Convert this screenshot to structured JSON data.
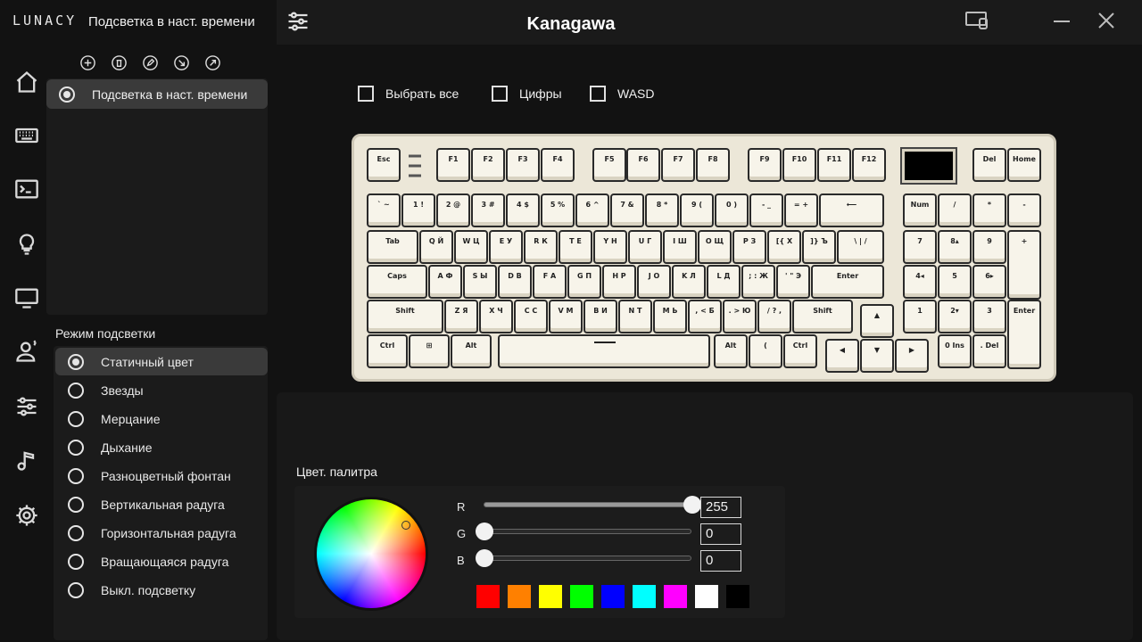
{
  "app": {
    "logo": "LUNACY",
    "profile_title": "Подсветка в наст. времени",
    "window_title": "Kanagawa"
  },
  "nav": {
    "items": [
      {
        "icon": "home-icon"
      },
      {
        "icon": "keyboard-icon"
      },
      {
        "icon": "terminal-icon"
      },
      {
        "icon": "lightbulb-icon"
      },
      {
        "icon": "monitor-icon"
      },
      {
        "icon": "user-icon"
      },
      {
        "icon": "sliders-icon"
      },
      {
        "icon": "music-icon"
      },
      {
        "icon": "gear-icon"
      }
    ]
  },
  "profile_tools": [
    {
      "icon": "add-icon"
    },
    {
      "icon": "delete-icon"
    },
    {
      "icon": "edit-icon"
    },
    {
      "icon": "import-icon"
    },
    {
      "icon": "export-icon"
    }
  ],
  "profiles": [
    {
      "label": "Подсветка в наст. времени",
      "selected": true
    }
  ],
  "lighting": {
    "header": "Режим подсветки",
    "modes": [
      {
        "label": "Статичный цвет",
        "selected": true
      },
      {
        "label": "Звезды",
        "selected": false
      },
      {
        "label": "Мерцание",
        "selected": false
      },
      {
        "label": "Дыхание",
        "selected": false
      },
      {
        "label": "Разноцветный фонтан",
        "selected": false
      },
      {
        "label": "Вертикальная радуга",
        "selected": false
      },
      {
        "label": "Горизонтальная радуга",
        "selected": false
      },
      {
        "label": "Вращающаяся радуга",
        "selected": false
      },
      {
        "label": "Выкл. подсветку",
        "selected": false
      }
    ]
  },
  "selection": {
    "select_all": "Выбрать все",
    "digits": "Цифры",
    "wasd": "WASD"
  },
  "keyboard": {
    "rows": [
      [
        "Esc",
        "F1",
        "F2",
        "F3",
        "F4",
        "F5",
        "F6",
        "F7",
        "F8",
        "F9",
        "F10",
        "F11",
        "F12",
        "Del",
        "Home"
      ],
      [
        "` ~",
        "1 !",
        "2 @",
        "3 #",
        "4 $",
        "5 %",
        "6 ^",
        "7 &",
        "8 *",
        "9 (",
        "0 )",
        "- _",
        "= +",
        "⟵",
        "Num",
        "/",
        "*",
        "-"
      ],
      [
        "Tab",
        "Q Й",
        "W Ц",
        "E У",
        "R К",
        "T Е",
        "Y Н",
        "U Г",
        "I Ш",
        "O Щ",
        "P З",
        "[{ Х",
        "]} Ъ",
        "\\ | /",
        "7",
        "8▴",
        "9",
        "+"
      ],
      [
        "Caps",
        "A Ф",
        "S Ы",
        "D В",
        "F А",
        "G П",
        "H Р",
        "J О",
        "K Л",
        "L Д",
        "; : Ж",
        "' \" Э",
        "Enter",
        "4◂",
        "5",
        "6▸"
      ],
      [
        "Shift",
        "Z Я",
        "X Ч",
        "C С",
        "V М",
        "B И",
        "N Т",
        "M Ь",
        ", < Б",
        ". > Ю",
        "/ ? ,",
        "Shift",
        "▲",
        "1",
        "2▾",
        "3",
        "Enter"
      ],
      [
        "Ctrl",
        "⊞",
        "Alt",
        "Space",
        "Alt",
        "(",
        "Ctrl",
        "◀",
        "▼",
        "▶",
        "0 Ins",
        ". Del"
      ]
    ]
  },
  "palette": {
    "label": "Цвет. палитра",
    "r_label": "R",
    "g_label": "G",
    "b_label": "B",
    "r": "255",
    "g": "0",
    "b": "0",
    "swatches": [
      "#ff0000",
      "#ff8000",
      "#ffff00",
      "#00ff00",
      "#0000ff",
      "#00ffff",
      "#ff00ff",
      "#ffffff",
      "#000000"
    ]
  }
}
